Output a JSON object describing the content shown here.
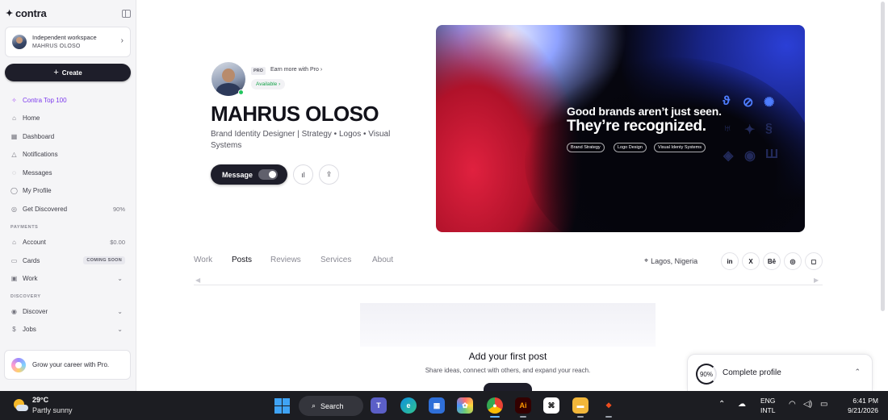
{
  "sidebar": {
    "brand": "contra",
    "workspace": {
      "kind": "Independent workspace",
      "name": "MAHRUS OLOSO"
    },
    "create_label": "Create",
    "items": [
      {
        "label": "Contra Top 100"
      },
      {
        "label": "Home"
      },
      {
        "label": "Dashboard"
      },
      {
        "label": "Notifications"
      },
      {
        "label": "Messages"
      },
      {
        "label": "My Profile"
      },
      {
        "label": "Get Discovered",
        "value": "90%"
      }
    ],
    "payments_header": "PAYMENTS",
    "payments": [
      {
        "label": "Account",
        "value": "$0.00"
      },
      {
        "label": "Cards",
        "badge": "COMING SOON"
      },
      {
        "label": "Work"
      }
    ],
    "discovery_header": "DISCOVERY",
    "discovery": [
      {
        "label": "Discover"
      },
      {
        "label": "Jobs"
      }
    ],
    "pro_card": "Grow your career with Pro."
  },
  "profile": {
    "pro_tag": "PRO",
    "earn_link": "Earn more with Pro",
    "status": "Available",
    "name": "MAHRUS OLOSO",
    "headline": "Brand Identity Designer | Strategy • Logos • Visual Systems",
    "message_label": "Message"
  },
  "banner": {
    "line1": "Good brands aren’t just seen.",
    "line2": "They’re recognized.",
    "chips": [
      "Brand Strategy",
      "Logo Design",
      "Visual Identy Systems"
    ]
  },
  "tabs": [
    "Work",
    "Posts",
    "Reviews",
    "Services",
    "About"
  ],
  "active_tab": "Posts",
  "location": "Lagos, Nigeria",
  "socials": [
    "in",
    "X",
    "Bē",
    "◎",
    "◻"
  ],
  "empty_state": {
    "title": "Add your first post",
    "subtitle": "Share ideas, connect with others, and expand your reach."
  },
  "complete_profile": {
    "percent": "90%",
    "label": "Complete profile"
  },
  "taskbar": {
    "temp": "29°C",
    "condition": "Partly sunny",
    "search": "Search",
    "lang": "ENG",
    "layout": "INTL",
    "time": "6:41 PM",
    "date": "9/21/2026"
  }
}
